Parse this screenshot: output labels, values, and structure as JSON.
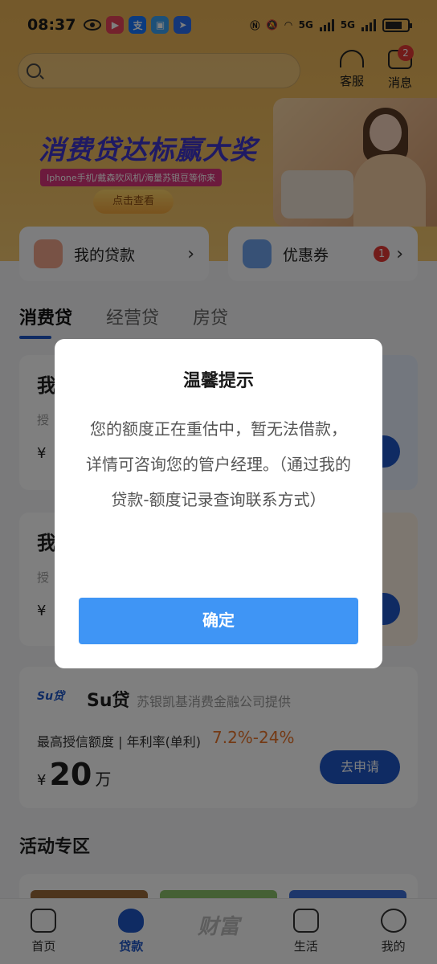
{
  "status_bar": {
    "time": "08:37",
    "network_labels": [
      "5G",
      "5G"
    ]
  },
  "search": {
    "placeholder": ""
  },
  "top_actions": [
    {
      "label": "客服",
      "icon": "headset-icon"
    },
    {
      "label": "消息",
      "icon": "message-icon",
      "badge": "2"
    }
  ],
  "banner": {
    "title": "消费贷达标赢大奖",
    "subtitle": "Iphone手机/戴森吹风机/海量苏银豆等你来",
    "button": "点击查看"
  },
  "quick_cards": [
    {
      "label": "我的贷款",
      "icon": "money-bag-icon"
    },
    {
      "label": "优惠券",
      "icon": "coupon-icon",
      "badge": "1"
    }
  ],
  "tabs": [
    "消费贷",
    "经营贷",
    "房贷"
  ],
  "loan_cards": [
    {
      "title": "我",
      "sub": "授",
      "currency": "¥"
    },
    {
      "title": "我",
      "sub": "授",
      "currency": "¥"
    }
  ],
  "su_card": {
    "logo": "Su贷",
    "name": "Su贷",
    "provider": "苏银凯基消费金融公司提供",
    "quota_label": "最高授信额度 | 年利率(单利)",
    "rate": "7.2%-24%",
    "currency": "¥",
    "amount": "20",
    "unit": "万",
    "apply": "去申请"
  },
  "activity": {
    "title": "活动专区"
  },
  "bottom_nav": [
    {
      "label": "首页",
      "icon": "home-icon"
    },
    {
      "label": "贷款",
      "icon": "loan-icon",
      "active": true
    },
    {
      "label": "财富",
      "icon": "wealth-logo-icon"
    },
    {
      "label": "生活",
      "icon": "cup-icon"
    },
    {
      "label": "我的",
      "icon": "profile-icon"
    }
  ],
  "dialog": {
    "title": "温馨提示",
    "message": "您的额度正在重估中，暂无法借款，详情可咨询您的管户经理。（通过我的贷款-额度记录查询联系方式）",
    "confirm": "确定"
  },
  "colors": {
    "accent": "#1e56c7",
    "dialog_button": "#3f95f5",
    "rate": "#e8742a",
    "badge": "#e53935"
  }
}
